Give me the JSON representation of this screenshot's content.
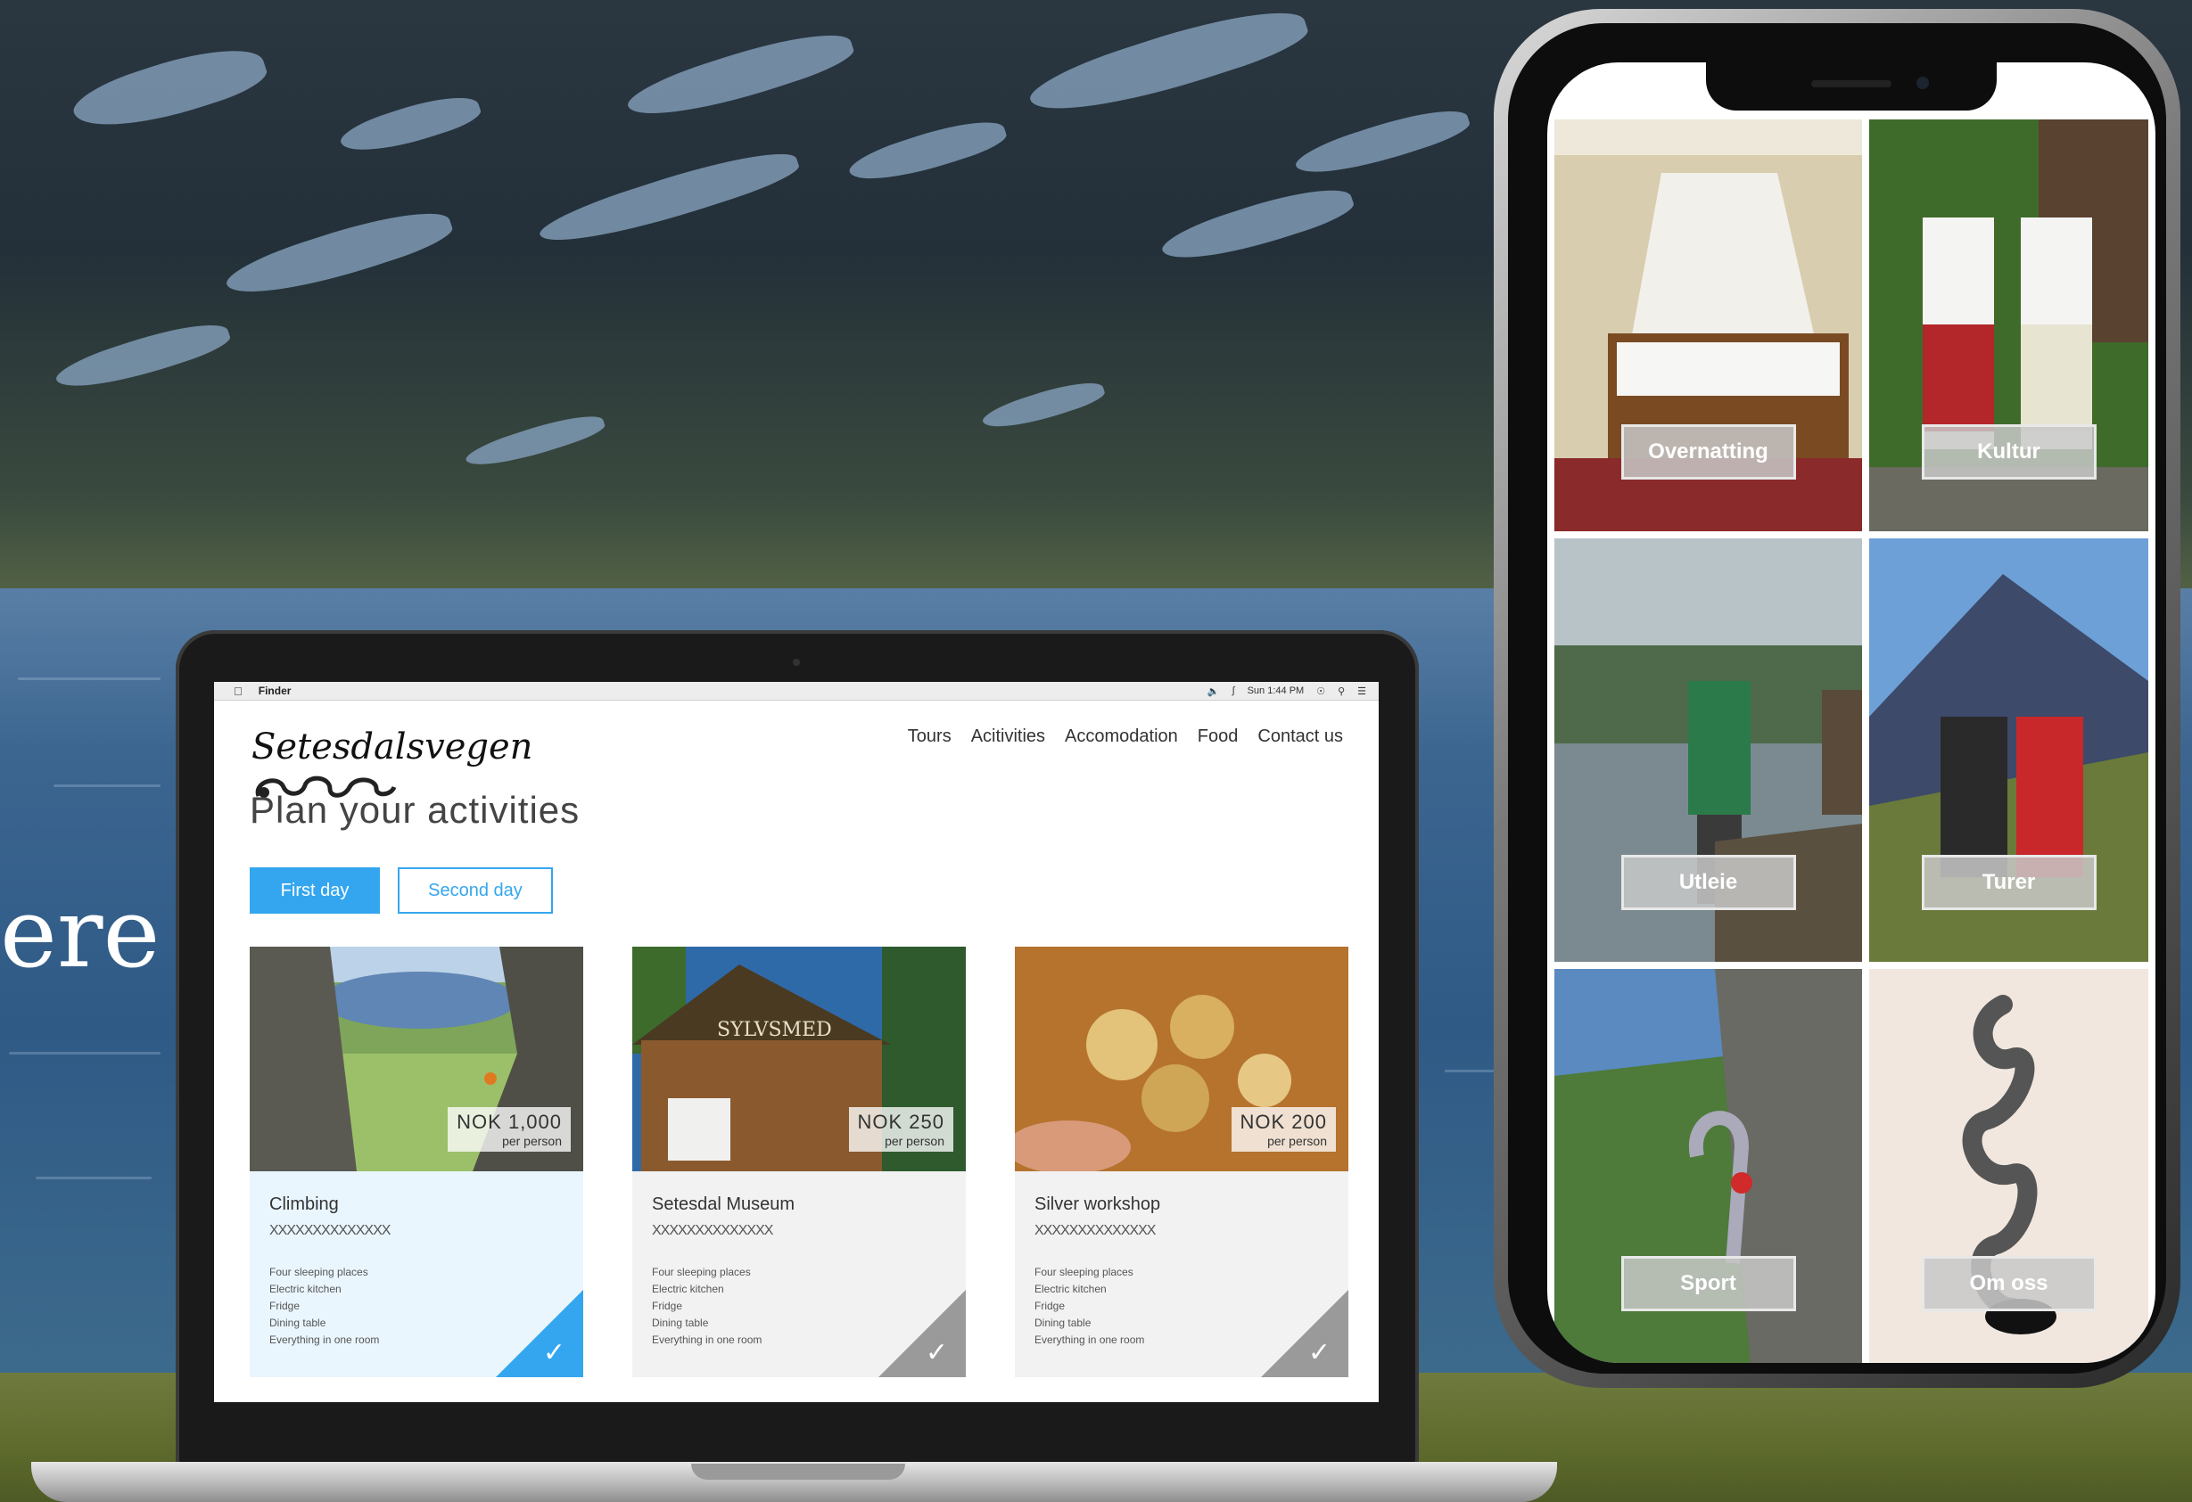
{
  "background": {
    "partial_heading": "ere"
  },
  "laptop": {
    "menubar": {
      "apple_icon": "apple-icon",
      "app": "Finder",
      "clock": "Sun 1:44 PM"
    },
    "logo": "Setesdalsvegen",
    "heading": "Plan your activities",
    "nav": [
      "Tours",
      "Acitivities",
      "Accomodation",
      "Food",
      "Contact us"
    ],
    "days": {
      "first": "First day",
      "second": "Second day"
    },
    "cards": [
      {
        "title": "Climbing",
        "sub": "XXXXXXXXXXXXXX",
        "price": "NOK 1,000",
        "per": "per person",
        "features": [
          "Four sleeping places",
          "Electric kitchen",
          "Fridge",
          "Dining table",
          "Everything in one room"
        ],
        "selected": true
      },
      {
        "title": "Setesdal Museum",
        "sub": "XXXXXXXXXXXXXX",
        "price": "NOK 250",
        "per": "per person",
        "features": [
          "Four sleeping places",
          "Electric kitchen",
          "Fridge",
          "Dining table",
          "Everything in one room"
        ],
        "selected": false
      },
      {
        "title": "Silver workshop",
        "sub": "XXXXXXXXXXXXXX",
        "price": "NOK 200",
        "per": "per person",
        "features": [
          "Four sleeping places",
          "Electric kitchen",
          "Fridge",
          "Dining table",
          "Everything in one room"
        ],
        "selected": false
      }
    ]
  },
  "phone": {
    "tiles": [
      "Overnatting",
      "Kultur",
      "Utleie",
      "Turer",
      "Sport",
      "Om oss"
    ]
  },
  "colors": {
    "accent": "#34a6ef"
  }
}
